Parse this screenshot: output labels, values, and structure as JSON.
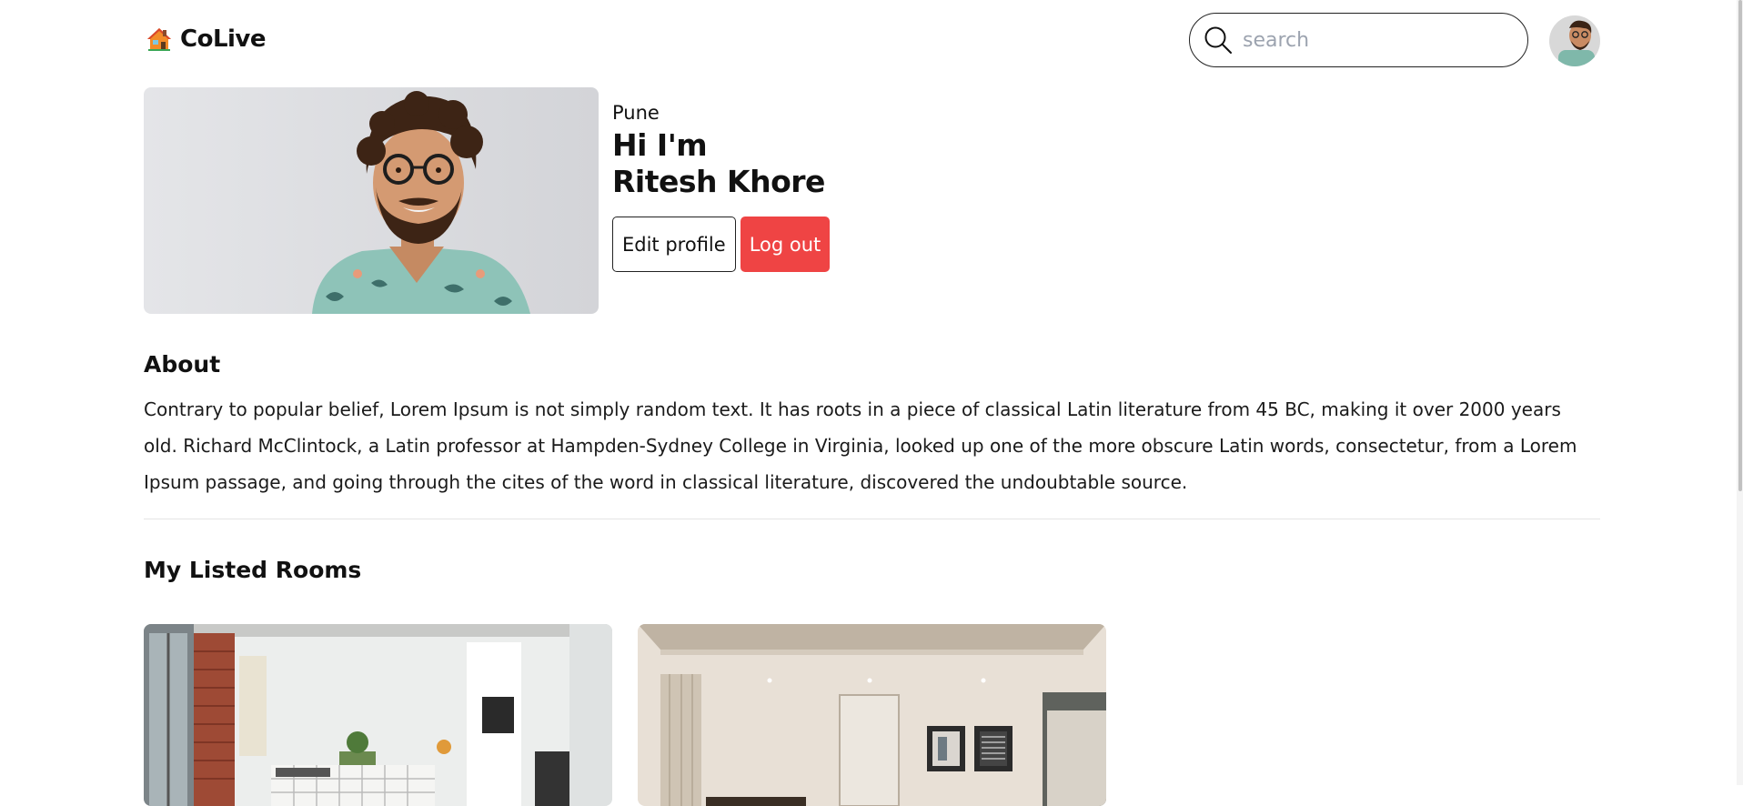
{
  "header": {
    "logo_text": "CoLive",
    "search_placeholder": "search"
  },
  "profile": {
    "city": "Pune",
    "greeting_line1": "Hi I'm",
    "greeting_line2": "Ritesh Khore",
    "edit_label": "Edit profile",
    "logout_label": "Log out"
  },
  "about": {
    "title": "About",
    "text": "Contrary to popular belief, Lorem Ipsum is not simply random text. It has roots in a piece of classical Latin literature from 45 BC, making it over 2000 years old. Richard McClintock, a Latin professor at Hampden-Sydney College in Virginia, looked up one of the more obscure Latin words, consectetur, from a Lorem Ipsum passage, and going through the cites of the word in classical literature, discovered the undoubtable source."
  },
  "rooms": {
    "title": "My Listed Rooms"
  },
  "colors": {
    "logout": "#ef4444",
    "text": "#111111",
    "divider": "#e5e5e5"
  },
  "icons": {
    "logo": "house-icon",
    "search": "search-icon"
  }
}
